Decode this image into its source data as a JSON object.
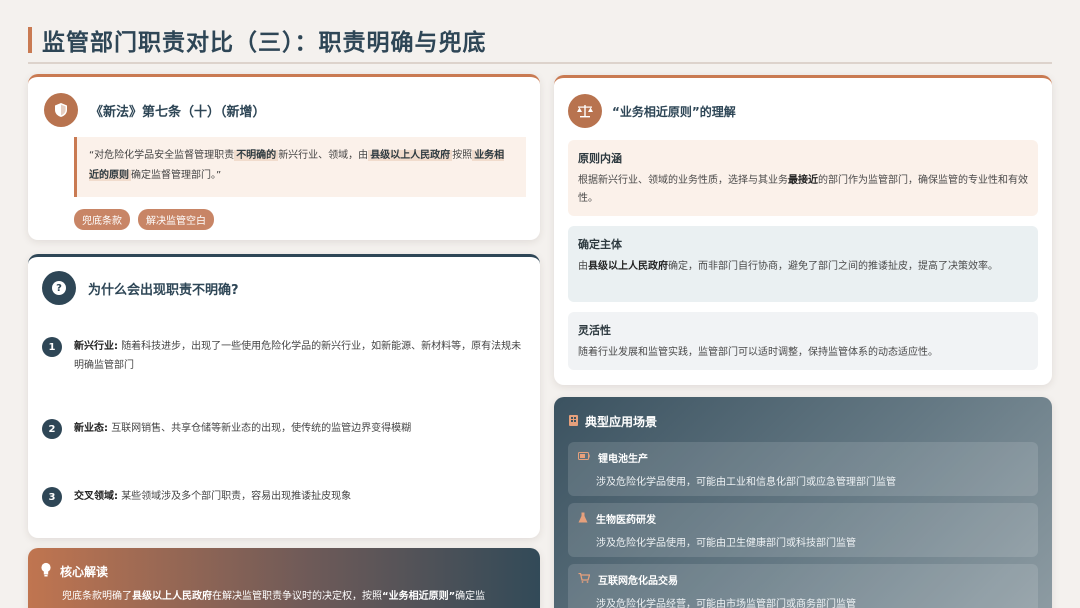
{
  "header": {
    "title": "监管部门职责对比（三）：职责明确与兜底"
  },
  "law_card": {
    "title": "《新法》第七条（十）（新增）",
    "quote_parts": [
      "“对危险化学品安全监督管理职责",
      "不明确的",
      "新兴行业、领域，由",
      "县级以上人民政府",
      "按照",
      "业务相近的原则",
      "确定监督管理部门。”"
    ],
    "tags": [
      "兜底条款",
      "解决监管空白"
    ]
  },
  "why_card": {
    "badge": "?",
    "title": "为什么会出现职责不明确?",
    "reasons": [
      {
        "num": "1",
        "label": "新兴行业:",
        "text": "随着科技进步，出现了一些使用危险化学品的新兴行业，如新能源、新材料等，原有法规未明确监管部门"
      },
      {
        "num": "2",
        "label": "新业态:",
        "text": "互联网销售、共享仓储等新业态的出现，使传统的监管边界变得模糊"
      },
      {
        "num": "3",
        "label": "交叉领域:",
        "text": "某些领域涉及多个部门职责，容易出现推诿扯皮现象"
      }
    ]
  },
  "core_card": {
    "title": "核心解读",
    "text_parts": [
      "兜底条款明确了",
      "县级以上人民政府",
      "在解决监管职责争议时的决定权，按照",
      "“业务相近原则”",
      "确定监"
    ]
  },
  "principle_card": {
    "title": "“业务相近原则”的理解",
    "items": [
      {
        "heading": "原则内涵",
        "parts": [
          "根据新兴行业、领域的业务性质，选择与其业务",
          "最接近",
          "的部门作为监管部门，确保监管的专业性和有效性。"
        ]
      },
      {
        "heading": "确定主体",
        "parts": [
          "由",
          "县级以上人民政府",
          "确定，而非部门自行协商，避免了部门之间的推诿扯皮，提高了决策效率。"
        ]
      },
      {
        "heading": "灵活性",
        "parts": [
          "随着行业发展和监管实践，监管部门可以适时调整，保持监管体系的动态适应性。"
        ]
      }
    ]
  },
  "scenario_card": {
    "title": "典型应用场景",
    "scenes": [
      {
        "title": "锂电池生产",
        "desc": "涉及危险化学品使用，可能由工业和信息化部门或应急管理部门监管"
      },
      {
        "title": "生物医药研发",
        "desc": "涉及危险化学品使用，可能由卫生健康部门或科技部门监管"
      },
      {
        "title": "互联网危化品交易",
        "desc": "涉及危险化学品经营，可能由市场监管部门或商务部门监管"
      }
    ]
  },
  "colors": {
    "accent": "#c97a52",
    "navy": "#2e4656",
    "quote_bg": "#fbf1ea"
  }
}
